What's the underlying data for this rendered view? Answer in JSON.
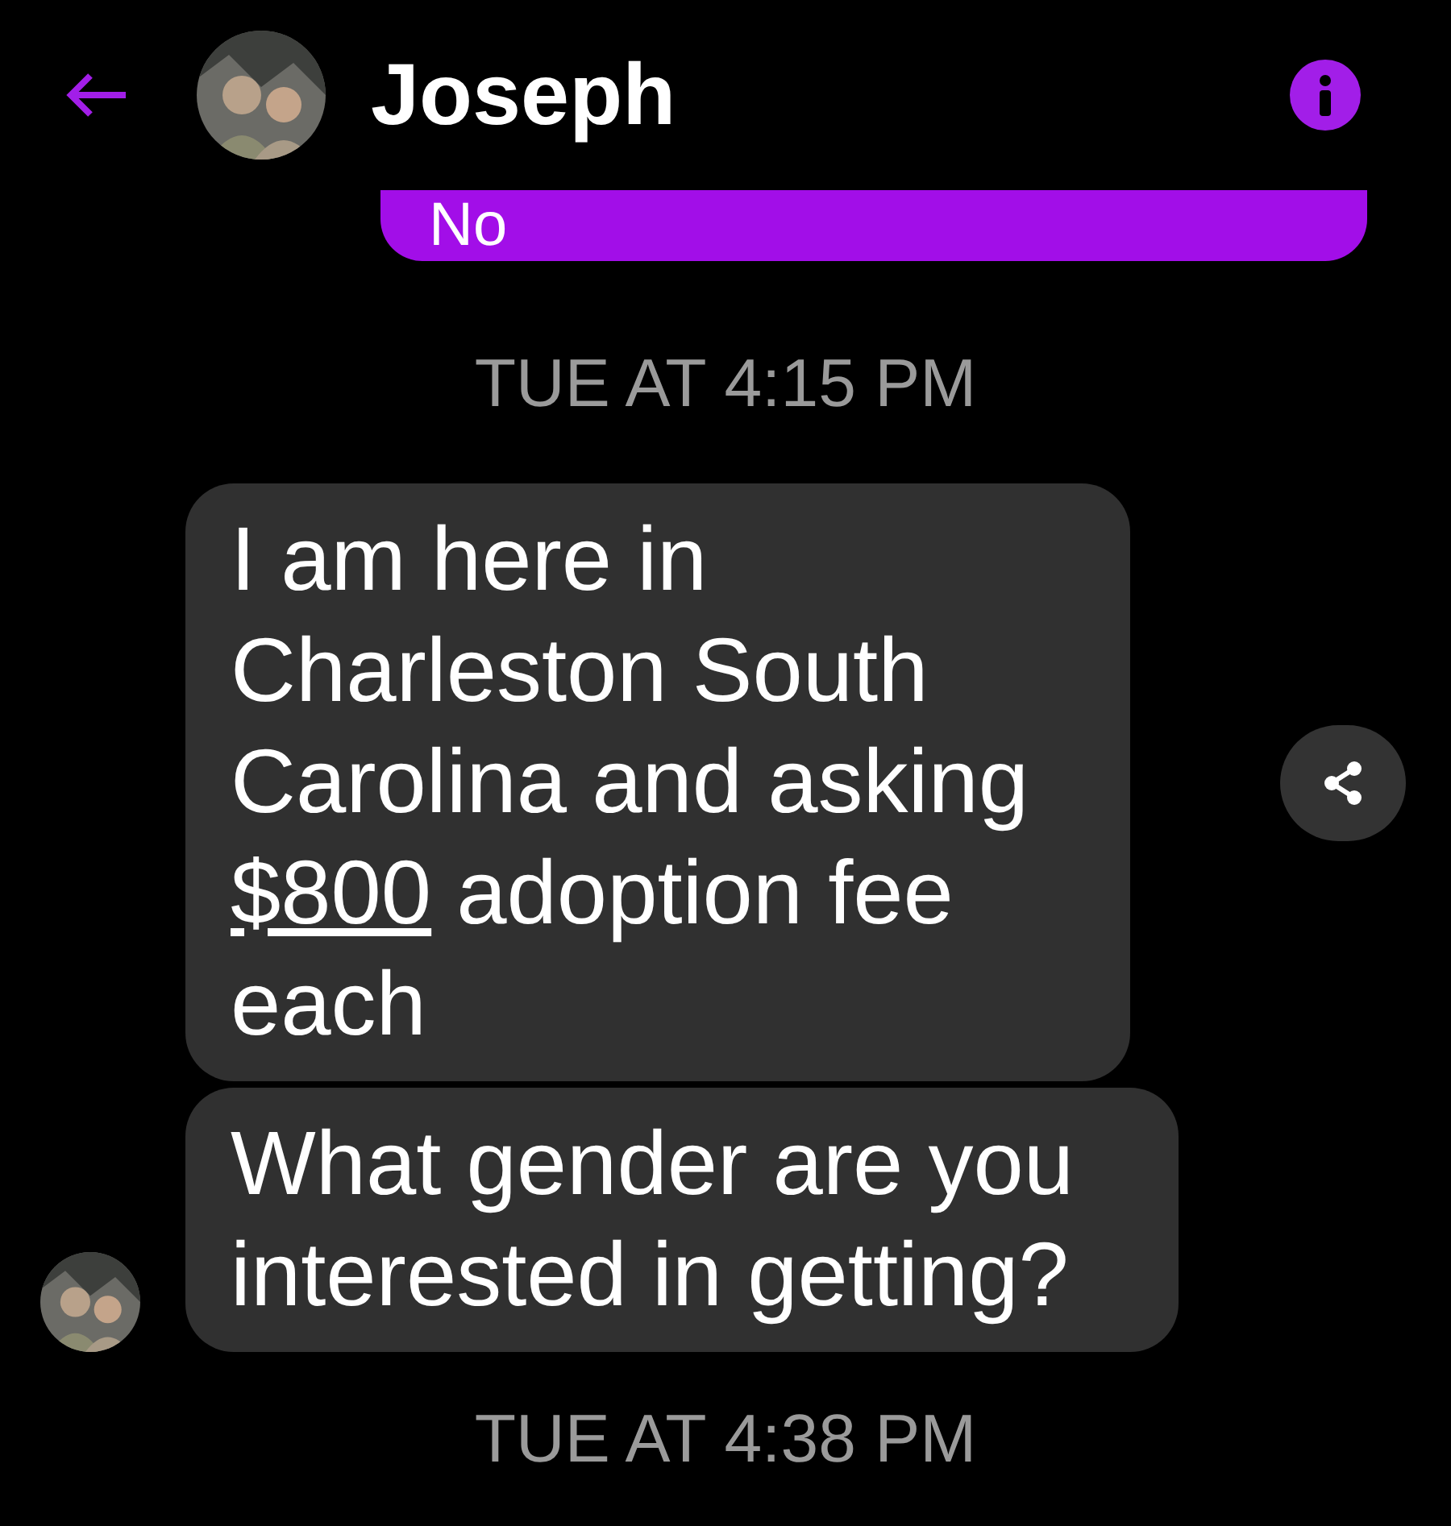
{
  "header": {
    "contact_name": "Joseph"
  },
  "messages": [
    {
      "kind": "outgoing",
      "parts": [
        {
          "text": "No"
        }
      ]
    },
    {
      "kind": "timestamp",
      "text": "TUE AT 4:15 PM"
    },
    {
      "kind": "incoming",
      "avatar": false,
      "share": true,
      "parts": [
        {
          "text": "I am here in Charleston South Carolina and asking "
        },
        {
          "text": "$800",
          "link": true
        },
        {
          "text": " adoption fee each"
        }
      ]
    },
    {
      "kind": "incoming",
      "avatar": true,
      "share": false,
      "parts": [
        {
          "text": "What gender are you interested in getting?"
        }
      ]
    },
    {
      "kind": "timestamp",
      "text": "TUE AT 4:38 PM"
    }
  ]
}
